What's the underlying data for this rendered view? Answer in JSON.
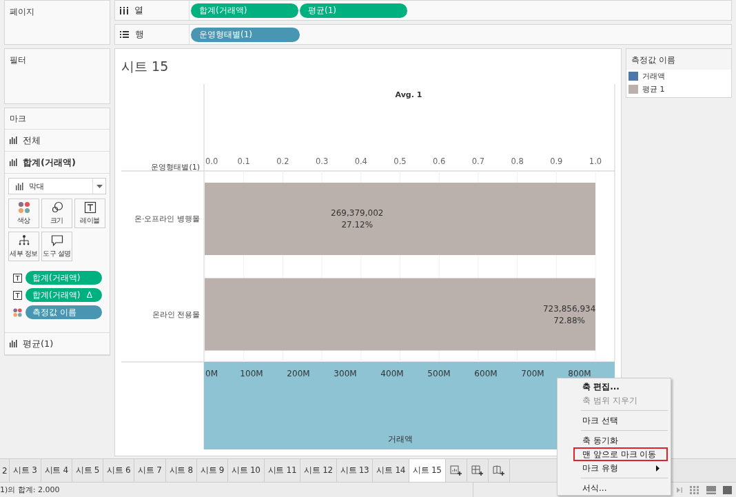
{
  "pages_card": {
    "title": "페이지"
  },
  "filters_card": {
    "title": "필터"
  },
  "marks_card": {
    "title": "마크",
    "mark_types": [
      {
        "label": "전체",
        "selected": false
      },
      {
        "label": "합계(거래액)",
        "selected": true
      },
      {
        "label": "평균(1)",
        "selected": false
      }
    ],
    "mark_type_dropdown": {
      "value": "막대"
    },
    "encoding_buttons": [
      {
        "kind": "color",
        "label": "색상"
      },
      {
        "kind": "size",
        "label": "크기"
      },
      {
        "kind": "label",
        "label": "레이블"
      },
      {
        "kind": "detail",
        "label": "세부 정보"
      },
      {
        "kind": "tooltip",
        "label": "도구 설명"
      }
    ],
    "fields": [
      {
        "kind": "label",
        "label": "합계(거래액)",
        "color": "#00b180"
      },
      {
        "kind": "label",
        "label": "합계(거래액)",
        "suffix": "Δ",
        "color": "#00b180"
      },
      {
        "kind": "color",
        "label": "측정값 이름",
        "color": "#4996b2"
      }
    ]
  },
  "columns_shelf": {
    "label": "열",
    "pills": [
      {
        "label": "합계(거래액)",
        "color": "#00b180"
      },
      {
        "label": "평균(1)",
        "color": "#00b180"
      }
    ]
  },
  "rows_shelf": {
    "label": "행",
    "pills": [
      {
        "label": "운영형태별(1)",
        "color": "#4996b2"
      }
    ]
  },
  "sheet": {
    "title": "시트 15",
    "row_header": "운영형태별(1)",
    "chart_data": {
      "type": "bar",
      "orientation": "horizontal",
      "title": "Avg. 1",
      "categories": [
        "온·오프라인 병행몰",
        "온라인 전용몰"
      ],
      "series": [
        {
          "color": "#bab0ac",
          "values": [
            1,
            1
          ]
        }
      ],
      "grid": true,
      "xlim": [
        0,
        1
      ],
      "xticks": [
        {
          "value": 0,
          "label": "0.0"
        },
        {
          "value": 0.1,
          "label": "0.1"
        },
        {
          "value": 0.2,
          "label": "0.2"
        },
        {
          "value": 0.3,
          "label": "0.3"
        },
        {
          "value": 0.4,
          "label": "0.4"
        },
        {
          "value": 0.5,
          "label": "0.5"
        },
        {
          "value": 0.6,
          "label": "0.6"
        },
        {
          "value": 0.7,
          "label": "0.7"
        },
        {
          "value": 0.8,
          "label": "0.8"
        },
        {
          "value": 0.9,
          "label": "0.9"
        },
        {
          "value": 1,
          "label": "1.0"
        }
      ],
      "value_labels": [
        [
          "269,379,002",
          "27.12%"
        ],
        [
          "723,856,934",
          "72.88%"
        ]
      ]
    },
    "bottom_axis": {
      "title": "거래액",
      "selected": true,
      "ticks": [
        "0M",
        "100M",
        "200M",
        "300M",
        "400M",
        "500M",
        "600M",
        "700M",
        "800M"
      ]
    }
  },
  "legend": {
    "title": "측정값 이름",
    "items": [
      {
        "label": "거래액",
        "color": "#4e79a7"
      },
      {
        "label": "평균 1",
        "color": "#bab0ac"
      }
    ]
  },
  "context_menu": {
    "items": [
      {
        "kind": "item",
        "label": "축 편집...",
        "bold": true,
        "disabled": false,
        "highlighted": false,
        "submenu": false
      },
      {
        "kind": "item",
        "label": "축 범위 지우기",
        "bold": false,
        "disabled": true,
        "highlighted": false,
        "submenu": false
      },
      {
        "kind": "separator"
      },
      {
        "kind": "item",
        "label": "마크 선택",
        "bold": false,
        "disabled": false,
        "highlighted": false,
        "submenu": false
      },
      {
        "kind": "separator"
      },
      {
        "kind": "item",
        "label": "축 동기화",
        "bold": false,
        "disabled": false,
        "highlighted": false,
        "submenu": false
      },
      {
        "kind": "item",
        "label": "맨 앞으로 마크 이동",
        "bold": false,
        "disabled": false,
        "highlighted": true,
        "submenu": false
      },
      {
        "kind": "item",
        "label": "마크 유형",
        "bold": false,
        "disabled": false,
        "highlighted": false,
        "submenu": true
      },
      {
        "kind": "separator"
      },
      {
        "kind": "item",
        "label": "서식...",
        "bold": false,
        "disabled": false,
        "highlighted": false,
        "submenu": false
      }
    ]
  },
  "sheet_tabs": [
    {
      "label": "2",
      "selected": false
    },
    {
      "label": "시트 3",
      "selected": false
    },
    {
      "label": "시트 4",
      "selected": false
    },
    {
      "label": "시트 5",
      "selected": false
    },
    {
      "label": "시트 6",
      "selected": false
    },
    {
      "label": "시트 7",
      "selected": false
    },
    {
      "label": "시트 8",
      "selected": false
    },
    {
      "label": "시트 9",
      "selected": false
    },
    {
      "label": "시트 10",
      "selected": false
    },
    {
      "label": "시트 11",
      "selected": false
    },
    {
      "label": "시트 12",
      "selected": false
    },
    {
      "label": "시트 13",
      "selected": false
    },
    {
      "label": "시트 14",
      "selected": false
    },
    {
      "label": "시트 15",
      "selected": true
    }
  ],
  "status_bar": {
    "text": "1)의 합계: 2.000"
  }
}
